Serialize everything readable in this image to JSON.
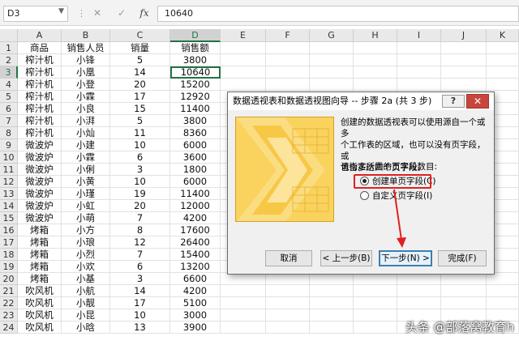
{
  "formula_bar": {
    "cell_ref": "D3",
    "cancel_icon": "✕",
    "enter_icon": "✓",
    "fx_label": "fx",
    "value": "10640"
  },
  "sheet": {
    "columns": [
      "A",
      "B",
      "C",
      "D",
      "E",
      "F",
      "G",
      "H",
      "I",
      "J",
      "K"
    ],
    "selected_column": "D",
    "selected_row": "3",
    "rows": [
      {
        "n": "1",
        "a": "商品",
        "b": "销售人员",
        "c": "销量",
        "d": "销售额"
      },
      {
        "n": "2",
        "a": "榨汁机",
        "b": "小锋",
        "c": "5",
        "d": "3800"
      },
      {
        "n": "3",
        "a": "榨汁机",
        "b": "小凰",
        "c": "14",
        "d": "10640"
      },
      {
        "n": "4",
        "a": "榨汁机",
        "b": "小登",
        "c": "20",
        "d": "15200"
      },
      {
        "n": "5",
        "a": "榨汁机",
        "b": "小霖",
        "c": "17",
        "d": "12920"
      },
      {
        "n": "6",
        "a": "榨汁机",
        "b": "小良",
        "c": "15",
        "d": "11400"
      },
      {
        "n": "7",
        "a": "榨汁机",
        "b": "小湃",
        "c": "5",
        "d": "3800"
      },
      {
        "n": "8",
        "a": "榨汁机",
        "b": "小灿",
        "c": "11",
        "d": "8360"
      },
      {
        "n": "9",
        "a": "微波炉",
        "b": "小建",
        "c": "10",
        "d": "6000"
      },
      {
        "n": "10",
        "a": "微波炉",
        "b": "小霖",
        "c": "6",
        "d": "3600"
      },
      {
        "n": "11",
        "a": "微波炉",
        "b": "小俐",
        "c": "3",
        "d": "1800"
      },
      {
        "n": "12",
        "a": "微波炉",
        "b": "小黄",
        "c": "10",
        "d": "6000"
      },
      {
        "n": "13",
        "a": "微波炉",
        "b": "小瑾",
        "c": "19",
        "d": "11400"
      },
      {
        "n": "14",
        "a": "微波炉",
        "b": "小虹",
        "c": "20",
        "d": "12000"
      },
      {
        "n": "15",
        "a": "微波炉",
        "b": "小萌",
        "c": "7",
        "d": "4200"
      },
      {
        "n": "16",
        "a": "烤箱",
        "b": "小方",
        "c": "8",
        "d": "17600"
      },
      {
        "n": "17",
        "a": "烤箱",
        "b": "小琅",
        "c": "12",
        "d": "26400"
      },
      {
        "n": "18",
        "a": "烤箱",
        "b": "小烈",
        "c": "7",
        "d": "15400"
      },
      {
        "n": "19",
        "a": "烤箱",
        "b": "小欢",
        "c": "6",
        "d": "13200"
      },
      {
        "n": "20",
        "a": "烤箱",
        "b": "小基",
        "c": "3",
        "d": "6600"
      },
      {
        "n": "21",
        "a": "吹风机",
        "b": "小航",
        "c": "14",
        "d": "4200"
      },
      {
        "n": "22",
        "a": "吹风机",
        "b": "小靓",
        "c": "17",
        "d": "5100"
      },
      {
        "n": "23",
        "a": "吹风机",
        "b": "小昆",
        "c": "10",
        "d": "3000"
      },
      {
        "n": "24",
        "a": "吹风机",
        "b": "小晗",
        "c": "13",
        "d": "3900"
      }
    ]
  },
  "dialog": {
    "title": "数据透视表和数据透视图向导 -- 步骤 2a (共 3 步)",
    "help_label": "?",
    "close_label": "✕",
    "description_lines": [
      "创建的数据透视表可以使用源自一个或多",
      "个工作表的区域，也可以没有页字段，或",
      "包含多达四个页字段。"
    ],
    "prompt": "请指定所需的页字段数目:",
    "options": [
      {
        "label": "创建单页字段(C)",
        "selected": true
      },
      {
        "label": "自定义页字段(I)",
        "selected": false
      }
    ],
    "buttons": {
      "cancel": "取消",
      "back": "< 上一步(B)",
      "next": "下一步(N) >",
      "finish": "完成(F)"
    }
  },
  "watermark": "头条 @部落窝教育h",
  "colors": {
    "accent": "#217346",
    "highlight": "#e02020",
    "wizard_image": "#f7c94a"
  }
}
